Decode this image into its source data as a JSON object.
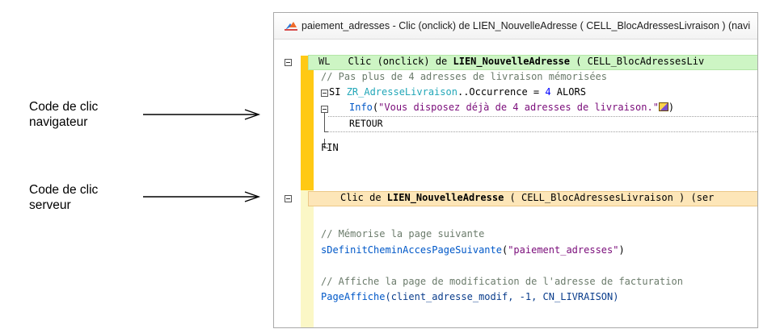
{
  "annotations": {
    "client": {
      "line1": "Code de clic",
      "line2": "navigateur"
    },
    "server": {
      "line1": "Code de clic",
      "line2": "serveur"
    }
  },
  "window": {
    "title": "paiement_adresses - Clic (onclick) de LIEN_NouvelleAdresse ( CELL_BlocAdressesLivraison ) (navi"
  },
  "browser_block": {
    "header_badge": "WL",
    "header_prefix": "Clic (onclick) de ",
    "header_link": "LIEN_NouvelleAdresse",
    "header_suffix": " ( CELL_BlocAdressesLiv",
    "line_comment": "// Pas plus de 4 adresses de livraison mémorisées",
    "si_kw": "SI ",
    "si_var": "ZR_AdresseLivraison",
    "si_rest": "..Occurrence = ",
    "si_num": "4",
    "si_alors": " ALORS",
    "info_fn": "Info",
    "info_open": "(",
    "info_str": "\"Vous disposez déjà de 4 adresses de livraison.\"",
    "info_close": ")",
    "retour": "RETOUR",
    "fin": "FIN"
  },
  "server_block": {
    "header_prefix": "Clic de ",
    "header_link": "LIEN_NouvelleAdresse",
    "header_suffix": " ( CELL_BlocAdressesLivraison ) (ser",
    "comment1": "// Mémorise la page suivante",
    "call1_fn": "sDefinitCheminAccesPageSuivante",
    "call1_open": "(",
    "call1_str": "\"paiement_adresses\"",
    "call1_close": ")",
    "comment2": "// Affiche la page de modification de l'adresse de facturation",
    "call2_fn": "PageAffiche",
    "call2_args": "(client_adresse_modif, -1, CN_LIVRAISON)"
  },
  "colors": {
    "gutter_active": "#ffc914",
    "gutter_inactive": "#fbf7c6",
    "browser_header": "#cdf5c4",
    "server_header": "#fde6b8",
    "function": "#0058c8",
    "string": "#7a0c7a",
    "number": "#0000ff"
  }
}
